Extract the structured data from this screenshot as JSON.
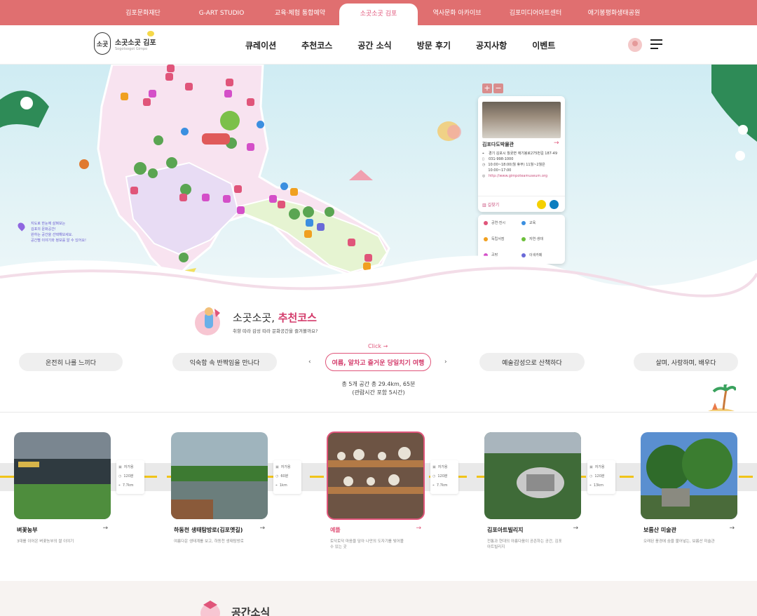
{
  "topbar": {
    "tabs": [
      {
        "label": "김포문화재단",
        "active": false
      },
      {
        "label": "G-ART STUDIO",
        "active": false
      },
      {
        "label": "교육·체험 통합예약",
        "active": false
      },
      {
        "label": "소곳소곳 김포",
        "active": true
      },
      {
        "label": "역사문화 아카이브",
        "active": false
      },
      {
        "label": "김포미디어아트센터",
        "active": false
      },
      {
        "label": "애기봉평화생태공원",
        "active": false
      }
    ]
  },
  "header": {
    "logo_mark": "소곳",
    "logo_text": "소곳소곳 김포",
    "logo_sub": "Sogotsogot Gimpo",
    "nav": [
      "큐레이션",
      "추천코스",
      "공간 소식",
      "방문 후기",
      "공지사항",
      "이벤트"
    ]
  },
  "map": {
    "zoom_in": "+",
    "zoom_out": "−",
    "hint_lines": [
      "지도로 한눈에 살펴보는",
      "김포의 문화공간!",
      "원하는 공간을 선택해보세요.",
      "공간별 이야기와 정보를 알 수 있어요!"
    ],
    "card": {
      "title": "김포다도박물관",
      "arrow": "→",
      "address": "경기 김포시 월곶면 애기봉로275번길 187-49",
      "phone": "031-998-1000",
      "hours": "10:00~18:00(월 휴무) 11월~2월은 10:00~17:00",
      "url": "http://www.gimpoteamuseum.org",
      "route_label": "길찾기"
    },
    "legend": [
      {
        "label": "공연·전시",
        "color": "#e0557a"
      },
      {
        "label": "교육",
        "color": "#3b8fe0"
      },
      {
        "label": "독립서점",
        "color": "#f0a020"
      },
      {
        "label": "자연·생태",
        "color": "#6cbf3a"
      },
      {
        "label": "공방",
        "color": "#d44fc8"
      },
      {
        "label": "이색카페",
        "color": "#6a6ad8"
      }
    ]
  },
  "course": {
    "title_plain": "소곳소곳, ",
    "title_accent": "추천코스",
    "subtitle": "취향 따라 감성 따라 문화공간을 즐겨볼까요?",
    "click_hint": "Click →",
    "prev": "‹",
    "next": "›",
    "pills": [
      {
        "label": "온전히 나를 느끼다",
        "active": false
      },
      {
        "label": "익숙함 속 반짝임을 만나다",
        "active": false
      },
      {
        "label": "여름, 알차고 즐거운 당일치기 여행",
        "active": true
      },
      {
        "label": "예술감성으로 산책하다",
        "active": false
      },
      {
        "label": "살며, 사랑하며, 배우다",
        "active": false
      }
    ],
    "summary_line1": "총 5개 공간 총 29.4km, 65분",
    "summary_line2": "(관람시간 포함 5시간)"
  },
  "places": [
    {
      "name": "벼꽃농부",
      "desc": "3대를 이어온 벼꽃농부의 쌀 이야기",
      "arrow": "→",
      "active": false
    },
    {
      "name": "하동천 생태탐방로(김포옛길)",
      "desc": "여름다운 생태계를 보고, 하동천 생태탐방로",
      "arrow": "→",
      "active": false
    },
    {
      "name": "예뜰",
      "desc": "토닥토닥 마음을 담아 나만의 도자기를 빚어볼 수 있는 곳",
      "arrow": "→",
      "active": true
    },
    {
      "name": "김포아트빌리지",
      "desc": "전통과 현대의 아름다움이 공존하는 공간, 김포아트빌리지",
      "arrow": "→",
      "active": false
    },
    {
      "name": "보름산 미술관",
      "desc": "오래된 풍경에 숨을 불어넣는, 보름산 미술관",
      "arrow": "→",
      "active": false
    }
  ],
  "segments": [
    {
      "mode": "자가용",
      "time": "120분",
      "dist": "7.7km"
    },
    {
      "mode": "자가용",
      "time": "60분",
      "dist": "1km"
    },
    {
      "mode": "자가용",
      "time": "120분",
      "dist": "7.7km"
    },
    {
      "mode": "자가용",
      "time": "120분",
      "dist": "13km"
    }
  ],
  "news": {
    "title": "공간소식"
  }
}
